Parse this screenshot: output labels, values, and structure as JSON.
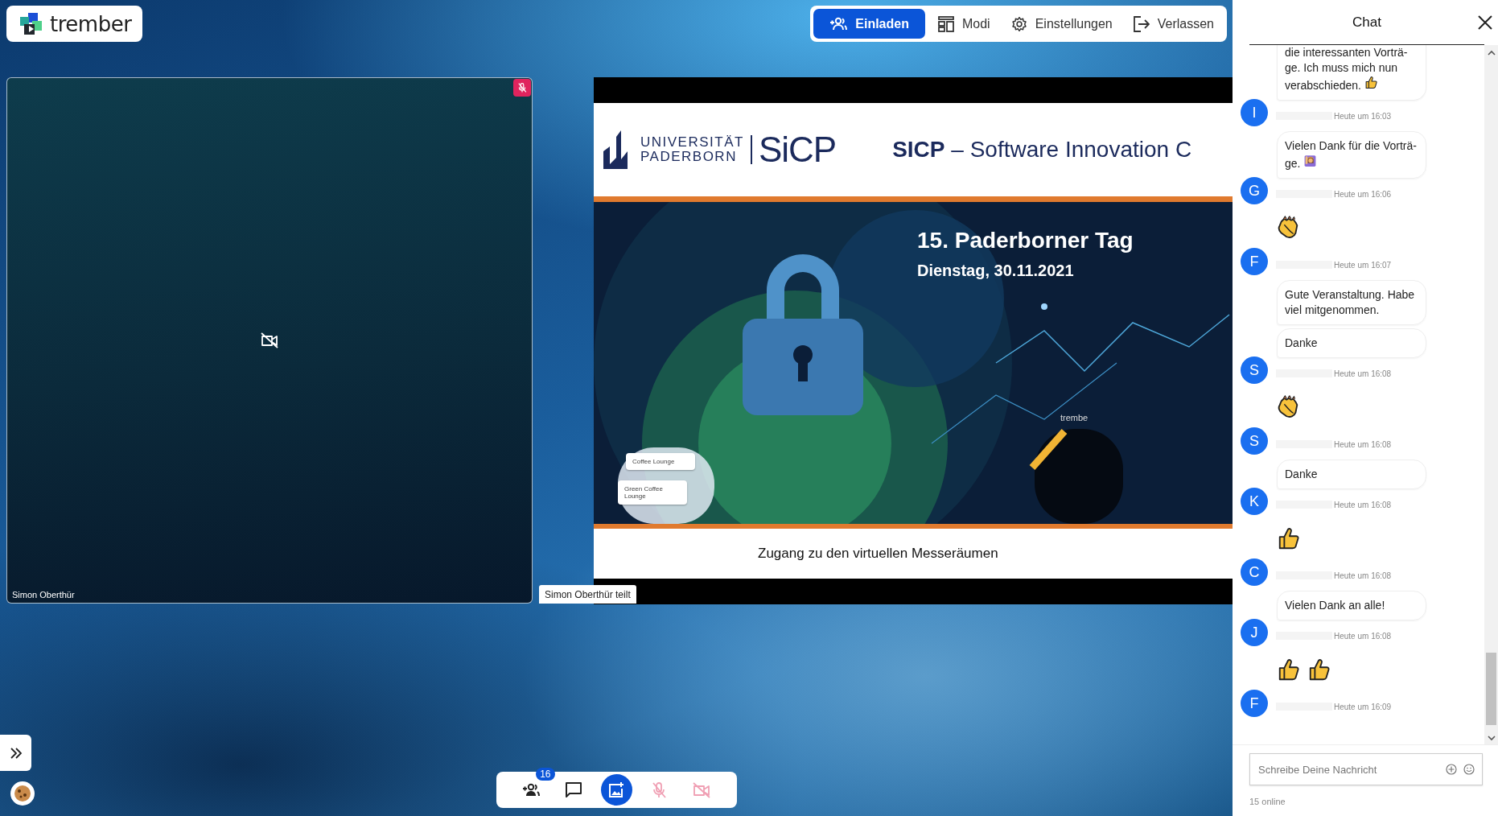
{
  "app": {
    "logo_text": "trember"
  },
  "toolbar": [
    {
      "label": "Einladen",
      "kind": "primary"
    },
    {
      "label": "Modi",
      "kind": "plain"
    },
    {
      "label": "Einstellungen",
      "kind": "plain"
    },
    {
      "label": "Verlassen",
      "kind": "plain"
    }
  ],
  "video_tile": {
    "name": "Simon Oberthür",
    "muted": true,
    "camera_off": true
  },
  "screen_share": {
    "caption": "Simon Oberthür teilt",
    "slide": {
      "university_top": "UNIVERSITÄT",
      "university_bottom": "PADERBORN",
      "logo": "SiCP",
      "title": "**SICP** – Software Innovation C",
      "heading": "15. Paderborner Tag",
      "date": "Dienstag, 30.11.2021",
      "lounge_1": "Coffee Lounge",
      "lounge_2": "Green Coffee Lounge",
      "app_name": "trembe",
      "footer": "Zugang zu den virtuellen Messeräumen"
    }
  },
  "call_controls": [
    {
      "badge": "16",
      "highlighted": false,
      "muted": false
    },
    {
      "highlighted": false,
      "muted": false
    },
    {
      "highlighted": true,
      "muted": false
    },
    {
      "highlighted": false,
      "muted": true
    },
    {
      "highlighted": false,
      "muted": true
    }
  ],
  "chat": {
    "title": "Chat",
    "messages": [
      {
        "initial": "I",
        "time": "Heute um 16:03",
        "items": [
          {
            "kind": "text",
            "text": "die interessanten Vorträ-ge. Ich muss mich nun verabschieden.",
            "trailing": {
              "kind": "thumbs-up"
            }
          }
        ]
      },
      {
        "initial": "G",
        "time": "Heute um 16:06",
        "items": [
          {
            "kind": "text",
            "text": "Vielen Dank für die Vorträ-ge.",
            "trailing": {
              "kind": "raising-hand"
            }
          }
        ]
      },
      {
        "initial": "F",
        "time": "Heute um 16:07",
        "items": [
          {
            "kind": "emoji",
            "glyphs": [
              {
                "kind": "clap"
              }
            ]
          }
        ]
      },
      {
        "initial": "S",
        "time": "Heute um 16:08",
        "items": [
          {
            "kind": "text",
            "text": "Gute Veranstaltung. Habe viel mitgenommen."
          },
          {
            "kind": "text",
            "text": "Danke"
          }
        ]
      },
      {
        "initial": "S",
        "time": "Heute um 16:08",
        "items": [
          {
            "kind": "emoji",
            "glyphs": [
              {
                "kind": "clap"
              }
            ]
          }
        ]
      },
      {
        "initial": "K",
        "time": "Heute um 16:08",
        "items": [
          {
            "kind": "text",
            "text": "Danke"
          }
        ]
      },
      {
        "initial": "C",
        "time": "Heute um 16:08",
        "items": [
          {
            "kind": "emoji",
            "glyphs": [
              {
                "kind": "thumbs-up"
              }
            ]
          }
        ]
      },
      {
        "initial": "J",
        "time": "Heute um 16:08",
        "items": [
          {
            "kind": "text",
            "text": "Vielen Dank an alle!"
          }
        ]
      },
      {
        "initial": "F",
        "time": "Heute um 16:09",
        "items": [
          {
            "kind": "emoji",
            "glyphs": [
              {
                "kind": "thumbs-up"
              },
              {
                "kind": "thumbs-up"
              }
            ]
          }
        ]
      }
    ],
    "input": {
      "placeholder": "Schreibe Deine Nachricht"
    },
    "online": "15 online"
  }
}
